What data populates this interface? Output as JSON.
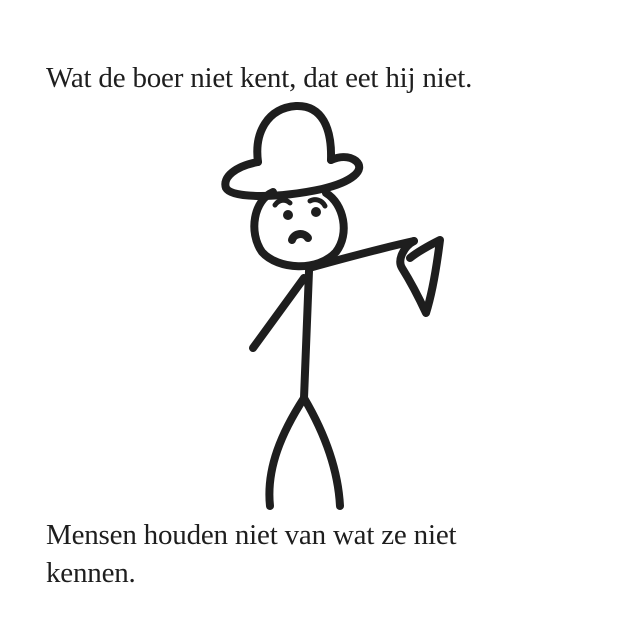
{
  "texts": {
    "top_caption": "Wat de boer niet kent, dat eet hij niet.",
    "bottom_caption": "Mensen houden niet van wat ze niet kennen."
  },
  "figure": {
    "icon": "farmer-stick-figure-icon",
    "ink_color": "#1e1e1e",
    "background_color": "#ffffff"
  }
}
